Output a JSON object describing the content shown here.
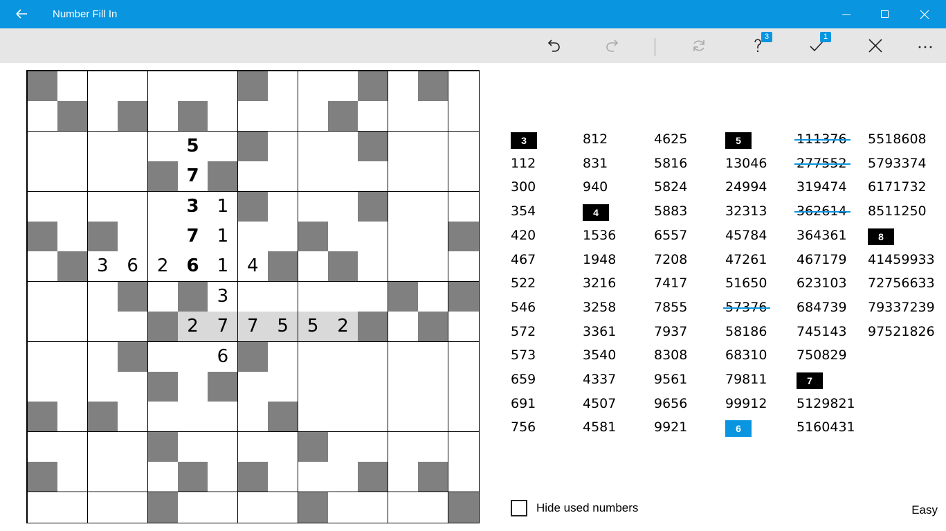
{
  "window": {
    "title": "Number Fill In"
  },
  "toolbar": {
    "hint_badge": "3",
    "check_badge": "1"
  },
  "grid": {
    "size": 15,
    "blacks": [
      [
        0,
        0
      ],
      [
        0,
        7
      ],
      [
        0,
        11
      ],
      [
        0,
        13
      ],
      [
        1,
        1
      ],
      [
        1,
        3
      ],
      [
        1,
        5
      ],
      [
        1,
        10
      ],
      [
        2,
        7
      ],
      [
        2,
        11
      ],
      [
        3,
        4
      ],
      [
        3,
        6
      ],
      [
        4,
        7
      ],
      [
        4,
        11
      ],
      [
        5,
        0
      ],
      [
        5,
        2
      ],
      [
        5,
        9
      ],
      [
        5,
        14
      ],
      [
        6,
        1
      ],
      [
        6,
        8
      ],
      [
        6,
        10
      ],
      [
        7,
        3
      ],
      [
        7,
        5
      ],
      [
        7,
        12
      ],
      [
        7,
        14
      ],
      [
        8,
        4
      ],
      [
        8,
        11
      ],
      [
        8,
        13
      ],
      [
        9,
        3
      ],
      [
        9,
        7
      ],
      [
        10,
        4
      ],
      [
        10,
        6
      ],
      [
        11,
        0
      ],
      [
        11,
        2
      ],
      [
        11,
        8
      ],
      [
        12,
        4
      ],
      [
        12,
        9
      ],
      [
        13,
        0
      ],
      [
        13,
        5
      ],
      [
        13,
        7
      ],
      [
        13,
        11
      ],
      [
        13,
        13
      ],
      [
        14,
        4
      ],
      [
        14,
        9
      ],
      [
        14,
        14
      ]
    ],
    "highlight": [
      [
        8,
        5
      ],
      [
        8,
        6
      ],
      [
        8,
        7
      ],
      [
        8,
        8
      ],
      [
        8,
        9
      ],
      [
        8,
        10
      ]
    ],
    "values": [
      {
        "r": 2,
        "c": 5,
        "v": "5",
        "given": true
      },
      {
        "r": 3,
        "c": 5,
        "v": "7",
        "given": true
      },
      {
        "r": 4,
        "c": 5,
        "v": "3",
        "given": true
      },
      {
        "r": 4,
        "c": 6,
        "v": "1",
        "given": false
      },
      {
        "r": 5,
        "c": 5,
        "v": "7",
        "given": true
      },
      {
        "r": 5,
        "c": 6,
        "v": "1",
        "given": false
      },
      {
        "r": 6,
        "c": 2,
        "v": "3",
        "given": false
      },
      {
        "r": 6,
        "c": 3,
        "v": "6",
        "given": false
      },
      {
        "r": 6,
        "c": 4,
        "v": "2",
        "given": false
      },
      {
        "r": 6,
        "c": 5,
        "v": "6",
        "given": true
      },
      {
        "r": 6,
        "c": 6,
        "v": "1",
        "given": false
      },
      {
        "r": 6,
        "c": 7,
        "v": "4",
        "given": false
      },
      {
        "r": 7,
        "c": 6,
        "v": "3",
        "given": false
      },
      {
        "r": 8,
        "c": 5,
        "v": "2",
        "given": false
      },
      {
        "r": 8,
        "c": 6,
        "v": "7",
        "given": false
      },
      {
        "r": 8,
        "c": 7,
        "v": "7",
        "given": false
      },
      {
        "r": 8,
        "c": 8,
        "v": "5",
        "given": false
      },
      {
        "r": 8,
        "c": 9,
        "v": "5",
        "given": false
      },
      {
        "r": 8,
        "c": 10,
        "v": "2",
        "given": false
      },
      {
        "r": 9,
        "c": 6,
        "v": "6",
        "given": false
      }
    ]
  },
  "word_columns": [
    [
      {
        "header": "3"
      },
      {
        "text": "112"
      },
      {
        "text": "300"
      },
      {
        "text": "354"
      },
      {
        "text": "420"
      },
      {
        "text": "467"
      },
      {
        "text": "522"
      },
      {
        "text": "546"
      },
      {
        "text": "572"
      },
      {
        "text": "573"
      },
      {
        "text": "659"
      },
      {
        "text": "691"
      },
      {
        "text": "756"
      }
    ],
    [
      {
        "text": "812"
      },
      {
        "text": "831"
      },
      {
        "text": "940"
      },
      {
        "header": "4"
      },
      {
        "text": "1536"
      },
      {
        "text": "1948"
      },
      {
        "text": "3216"
      },
      {
        "text": "3258"
      },
      {
        "text": "3361"
      },
      {
        "text": "3540"
      },
      {
        "text": "4337"
      },
      {
        "text": "4507"
      },
      {
        "text": "4581"
      }
    ],
    [
      {
        "text": "4625"
      },
      {
        "text": "5816"
      },
      {
        "text": "5824"
      },
      {
        "text": "5883"
      },
      {
        "text": "6557"
      },
      {
        "text": "7208"
      },
      {
        "text": "7417"
      },
      {
        "text": "7855"
      },
      {
        "text": "7937"
      },
      {
        "text": "8308"
      },
      {
        "text": "9561"
      },
      {
        "text": "9656"
      },
      {
        "text": "9921"
      }
    ],
    [
      {
        "header": "5"
      },
      {
        "text": "13046"
      },
      {
        "text": "24994"
      },
      {
        "text": "32313"
      },
      {
        "text": "45784"
      },
      {
        "text": "47261"
      },
      {
        "text": "51650"
      },
      {
        "text": "57376",
        "used": true
      },
      {
        "text": "58186"
      },
      {
        "text": "68310"
      },
      {
        "text": "79811"
      },
      {
        "text": "99912"
      },
      {
        "header": "6",
        "selected": true
      }
    ],
    [
      {
        "text": "111376",
        "used": true
      },
      {
        "text": "277552",
        "used": true
      },
      {
        "text": "319474"
      },
      {
        "text": "362614",
        "used": true
      },
      {
        "text": "364361"
      },
      {
        "text": "467179"
      },
      {
        "text": "623103"
      },
      {
        "text": "684739"
      },
      {
        "text": "745143"
      },
      {
        "text": "750829"
      },
      {
        "header": "7"
      },
      {
        "text": "5129821"
      },
      {
        "text": "5160431"
      }
    ],
    [
      {
        "text": "5518608"
      },
      {
        "text": "5793374"
      },
      {
        "text": "6171732"
      },
      {
        "text": "8511250"
      },
      {
        "header": "8"
      },
      {
        "text": "41459933"
      },
      {
        "text": "72756633"
      },
      {
        "text": "79337239"
      },
      {
        "text": "97521826"
      }
    ]
  ],
  "footer": {
    "hide_used_label": "Hide used numbers",
    "difficulty": "Easy"
  }
}
